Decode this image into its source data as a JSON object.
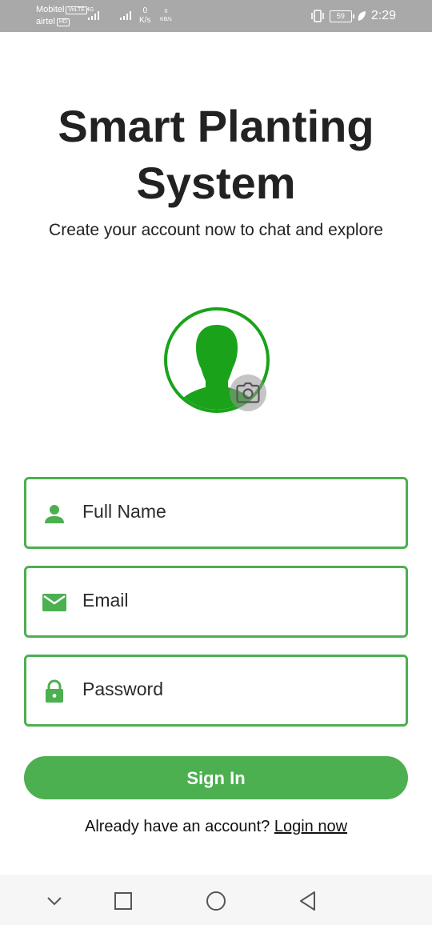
{
  "status_bar": {
    "carrier1": "Mobitel",
    "carrier1_badge": "VoLTE",
    "carrier2": "airtel",
    "carrier2_badge": "HD",
    "network_type": "4G",
    "speed1_value": "0",
    "speed1_unit": "K/s",
    "speed2_value": "0",
    "speed2_unit": "KB/s",
    "battery": "59",
    "time": "2:29"
  },
  "header": {
    "title_line1": "Smart Planting",
    "title_line2": "System",
    "subtitle": "Create your account now to chat and explore"
  },
  "avatar": {
    "icon": "person-silhouette-icon",
    "camera_icon": "camera-icon"
  },
  "form": {
    "full_name": {
      "placeholder": "Full Name",
      "icon": "person-icon"
    },
    "email": {
      "placeholder": "Email",
      "icon": "mail-icon"
    },
    "password": {
      "placeholder": "Password",
      "icon": "lock-icon"
    },
    "submit_label": "Sign In"
  },
  "footer": {
    "prompt": "Already have an account?",
    "link_label": "Login now"
  },
  "nav_bar": {
    "items": [
      "chevron-down-icon",
      "square-icon",
      "circle-icon",
      "back-triangle-icon"
    ]
  },
  "colors": {
    "accent": "#4caf50",
    "avatar_green": "#1aa31a",
    "status_bar": "#a9a9a9"
  }
}
